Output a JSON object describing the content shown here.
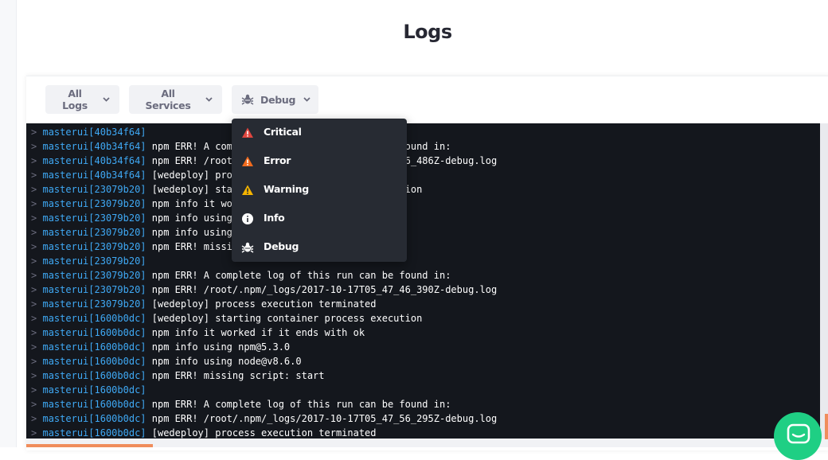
{
  "page": {
    "title": "Logs"
  },
  "filters": {
    "logs_label": "All Logs",
    "services_label": "All Services",
    "level_label": "Debug"
  },
  "level_menu": {
    "items": [
      {
        "label": "Critical",
        "icon": "critical-triangle-icon",
        "color": "#e0463f"
      },
      {
        "label": "Error",
        "icon": "error-triangle-icon",
        "color": "#f26b1d"
      },
      {
        "label": "Warning",
        "icon": "warning-triangle-icon",
        "color": "#f5b400"
      },
      {
        "label": "Info",
        "icon": "info-circle-icon",
        "color": "#ffffff"
      },
      {
        "label": "Debug",
        "icon": "bug-icon",
        "color": "#ffffff"
      }
    ]
  },
  "logs": [
    {
      "prompt": ">",
      "service": "masterui[40b34f64]",
      "message": ""
    },
    {
      "prompt": ">",
      "service": "masterui[40b34f64]",
      "message": "npm ERR! A complete log of this run can be found in:"
    },
    {
      "prompt": ">",
      "service": "masterui[40b34f64]",
      "message": "npm ERR! /root/.npm/_logs/2017-10-17T05_47_36_486Z-debug.log"
    },
    {
      "prompt": ">",
      "service": "masterui[40b34f64]",
      "message": "[wedeploy] process execution terminated"
    },
    {
      "prompt": ">",
      "service": "masterui[23079b20]",
      "message": "[wedeploy] starting container process execution"
    },
    {
      "prompt": ">",
      "service": "masterui[23079b20]",
      "message": "npm info it worked if it ends with ok"
    },
    {
      "prompt": ">",
      "service": "masterui[23079b20]",
      "message": "npm info using npm@5.3.0"
    },
    {
      "prompt": ">",
      "service": "masterui[23079b20]",
      "message": "npm info using node@v8.6.0"
    },
    {
      "prompt": ">",
      "service": "masterui[23079b20]",
      "message": "npm ERR! missing script: start"
    },
    {
      "prompt": ">",
      "service": "masterui[23079b20]",
      "message": ""
    },
    {
      "prompt": ">",
      "service": "masterui[23079b20]",
      "message": "npm ERR! A complete log of this run can be found in:"
    },
    {
      "prompt": ">",
      "service": "masterui[23079b20]",
      "message": "npm ERR! /root/.npm/_logs/2017-10-17T05_47_46_390Z-debug.log"
    },
    {
      "prompt": ">",
      "service": "masterui[23079b20]",
      "message": "[wedeploy] process execution terminated"
    },
    {
      "prompt": ">",
      "service": "masterui[1600b0dc]",
      "message": "[wedeploy] starting container process execution"
    },
    {
      "prompt": ">",
      "service": "masterui[1600b0dc]",
      "message": "npm info it worked if it ends with ok"
    },
    {
      "prompt": ">",
      "service": "masterui[1600b0dc]",
      "message": "npm info using npm@5.3.0"
    },
    {
      "prompt": ">",
      "service": "masterui[1600b0dc]",
      "message": "npm info using node@v8.6.0"
    },
    {
      "prompt": ">",
      "service": "masterui[1600b0dc]",
      "message": "npm ERR! missing script: start"
    },
    {
      "prompt": ">",
      "service": "masterui[1600b0dc]",
      "message": ""
    },
    {
      "prompt": ">",
      "service": "masterui[1600b0dc]",
      "message": "npm ERR! A complete log of this run can be found in:"
    },
    {
      "prompt": ">",
      "service": "masterui[1600b0dc]",
      "message": "npm ERR! /root/.npm/_logs/2017-10-17T05_47_56_295Z-debug.log"
    },
    {
      "prompt": ">",
      "service": "masterui[1600b0dc]",
      "message": "[wedeploy] process execution terminated"
    }
  ],
  "colors": {
    "console_bg": "#14171d",
    "service_text": "#3fa9f5",
    "accent": "#f08d5c",
    "chat": "#1fcf84"
  }
}
